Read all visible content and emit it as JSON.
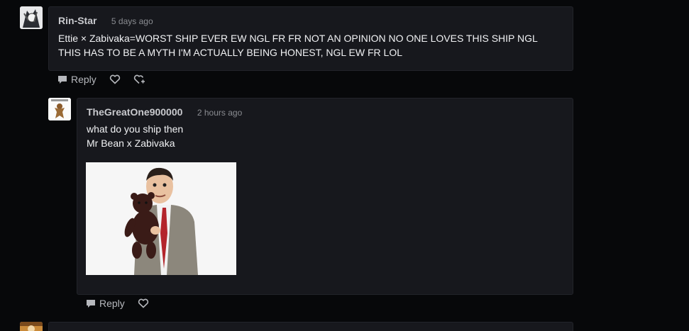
{
  "comments": [
    {
      "author": "Rin-Star",
      "time": "5 days ago",
      "text_lines": [
        "Ettie × Zabivaka=WORST SHIP EVER EW NGL FR FR NOT AN OPINION NO ONE LOVES THIS SHIP NGL",
        "THIS HAS TO BE A MYTH I'M ACTUALLY BEING HONEST, NGL EW FR LOL"
      ],
      "reply_label": "Reply"
    },
    {
      "author": "TheGreatOne900000",
      "time": "2 hours ago",
      "text_lines": [
        "what do you ship then",
        "Mr Bean x Zabivaka"
      ],
      "reply_label": "Reply"
    }
  ],
  "icons": {
    "reply": "speech-bubble-icon",
    "like": "heart-icon",
    "share": "heart-share-icon"
  },
  "colors": {
    "background": "#07080a",
    "card": "#17181d",
    "author": "#c9cace",
    "text": "#f1f2f4"
  }
}
